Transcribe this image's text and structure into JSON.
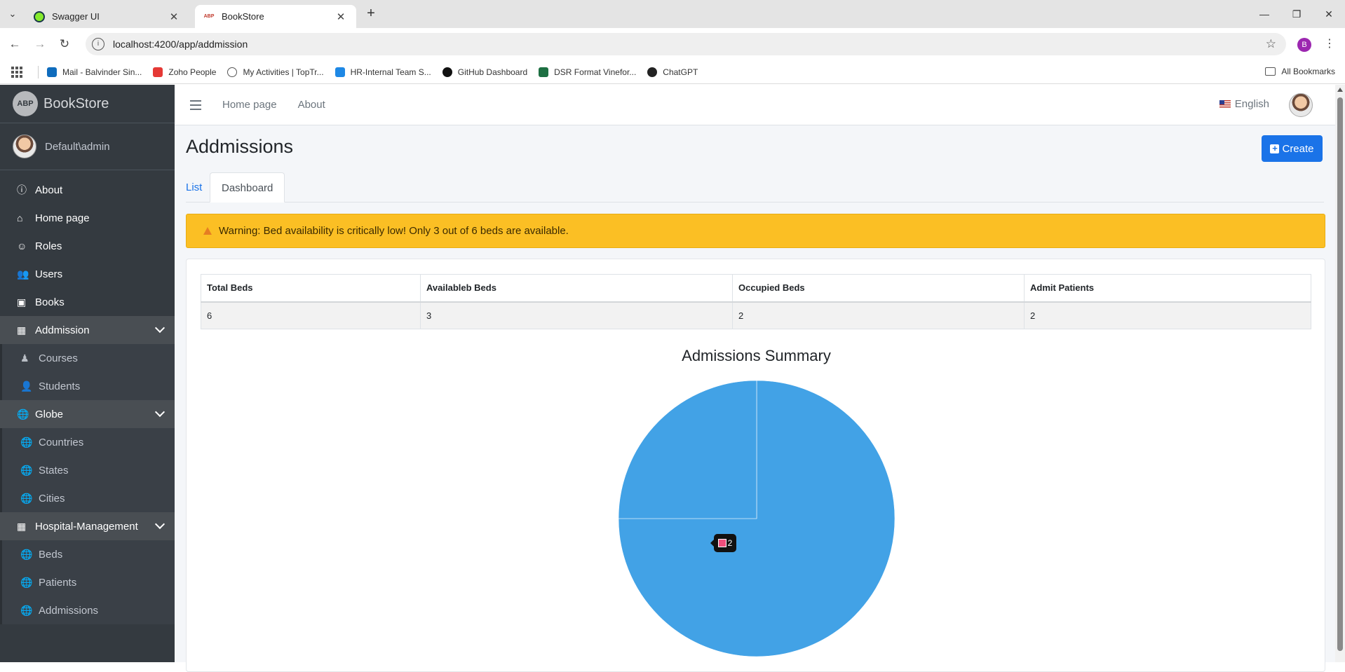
{
  "browser": {
    "tabs": [
      {
        "label": "Swagger UI",
        "close": "✕"
      },
      {
        "label": "BookStore",
        "close": "✕"
      }
    ],
    "tab_menu": "⌄",
    "new_tab": "+",
    "window": {
      "minimize": "—",
      "restore": "❐",
      "close": "✕"
    },
    "nav": {
      "back": "←",
      "forward": "→",
      "reload": "↻"
    },
    "url": "localhost:4200/app/addmission",
    "site_info": "i",
    "star": "☆",
    "profile_initial": "B",
    "menu": "⋮",
    "bookmarks": [
      {
        "label": "Mail - Balvinder Sin...",
        "color": "#0f6cbd"
      },
      {
        "label": "Zoho People",
        "color": "#e53935"
      },
      {
        "label": "My Activities | TopTr...",
        "color": "#555555"
      },
      {
        "label": "HR-Internal Team S...",
        "color": "#1e88e5"
      },
      {
        "label": "GitHub Dashboard",
        "color": "#111111"
      },
      {
        "label": "DSR Format Vinefor...",
        "color": "#1d6f42"
      },
      {
        "label": "ChatGPT",
        "color": "#222222"
      }
    ],
    "all_bookmarks": "All Bookmarks"
  },
  "app": {
    "brand": {
      "logo": "ABP",
      "name": "BookStore"
    },
    "user": {
      "name": "Default\\admin"
    },
    "sidebar": [
      {
        "label": "About",
        "icon": "ⓘ",
        "type": "item"
      },
      {
        "label": "Home page",
        "icon": "⌂",
        "type": "item"
      },
      {
        "label": "Roles",
        "icon": "☺",
        "type": "item"
      },
      {
        "label": "Users",
        "icon": "👥",
        "type": "item"
      },
      {
        "label": "Books",
        "icon": "▣",
        "type": "item"
      },
      {
        "label": "Addmission",
        "icon": "▦",
        "type": "parent"
      },
      {
        "label": "Courses",
        "icon": "♟",
        "type": "child"
      },
      {
        "label": "Students",
        "icon": "👤",
        "type": "child"
      },
      {
        "label": "Globe",
        "icon": "🌐",
        "type": "parent"
      },
      {
        "label": "Countries",
        "icon": "🌐",
        "type": "child"
      },
      {
        "label": "States",
        "icon": "🌐",
        "type": "child"
      },
      {
        "label": "Cities",
        "icon": "🌐",
        "type": "child"
      },
      {
        "label": "Hospital-Management",
        "icon": "▦",
        "type": "parent"
      },
      {
        "label": "Beds",
        "icon": "🌐",
        "type": "child"
      },
      {
        "label": "Patients",
        "icon": "🌐",
        "type": "child"
      },
      {
        "label": "Addmissions",
        "icon": "🌐",
        "type": "child"
      }
    ],
    "topnav": {
      "home": "Home page",
      "about": "About",
      "language": "English"
    },
    "page": {
      "title": "Addmissions",
      "create_label": "Create",
      "create_icon": "+",
      "tabs": {
        "list": "List",
        "dashboard": "Dashboard"
      },
      "warning": "Warning: Bed availability is critically low! Only 3 out of 6 beds are available.",
      "table": {
        "headers": [
          "Total Beds",
          "Availableb Beds",
          "Occupied Beds",
          "Admit Patients"
        ],
        "row": [
          "6",
          "3",
          "2",
          "2"
        ]
      }
    }
  },
  "chart_data": {
    "type": "pie",
    "title": "Admissions Summary",
    "slices": [
      {
        "value": 6,
        "color": "#42a2e6"
      },
      {
        "value": 2,
        "color": "#42a2e6"
      }
    ],
    "tooltip": {
      "value": "2",
      "swatch_color": "#ef4f7c"
    }
  }
}
